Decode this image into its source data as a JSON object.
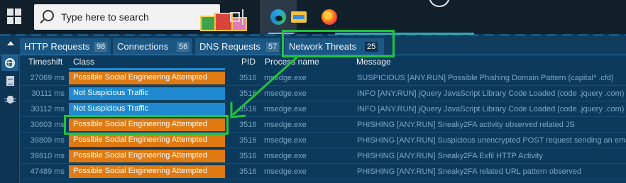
{
  "taskbar": {
    "search_placeholder": "Type here to search",
    "icons": [
      "windows-start-icon",
      "search-icon",
      "task-view-icon",
      "edge-icon",
      "file-explorer-icon",
      "firefox-icon"
    ]
  },
  "tabs": [
    {
      "label": "HTTP Requests",
      "count": "98"
    },
    {
      "label": "Connections",
      "count": "56"
    },
    {
      "label": "DNS Requests",
      "count": "57"
    },
    {
      "label": "Network Threats",
      "count": "25"
    }
  ],
  "columns": {
    "timeshift": "Timeshift",
    "class": "Class",
    "pid": "PID",
    "process": "Process name",
    "message": "Message"
  },
  "rows": [
    {
      "timeshift": "27069 ms",
      "class": "Possible Social Engineering Attempted",
      "type": "threat",
      "pid": "3516",
      "process": "msedge.exe",
      "message": "SUSPICIOUS [ANY.RUN] Possible Phishing Domain Pattern (capital* .cfd)"
    },
    {
      "timeshift": "30111 ms",
      "class": "Not Suspicious Traffic",
      "type": "ok",
      "pid": "3516",
      "process": "msedge.exe",
      "message": "INFO [ANY.RUN] jQuery JavaScript Library Code Loaded (code .jquery .com)"
    },
    {
      "timeshift": "30112 ms",
      "class": "Not Suspicious Traffic",
      "type": "ok",
      "pid": "3516",
      "process": "msedge.exe",
      "message": "INFO [ANY.RUN] jQuery JavaScript Library Code Loaded (code .jquery .com)"
    },
    {
      "timeshift": "30603 ms",
      "class": "Possible Social Engineering Attempted",
      "type": "threat",
      "pid": "3516",
      "process": "msedge.exe",
      "message": "PHISHING [ANY.RUN] Sneaky2FA activity observed related JS"
    },
    {
      "timeshift": "39809 ms",
      "class": "Possible Social Engineering Attempted",
      "type": "threat",
      "pid": "3516",
      "process": "msedge.exe",
      "message": "PHISHING [ANY.RUN] Suspicious unencrypted POST request sending an email a"
    },
    {
      "timeshift": "39810 ms",
      "class": "Possible Social Engineering Attempted",
      "type": "threat",
      "pid": "3516",
      "process": "msedge.exe",
      "message": "PHISHING [ANY.RUN] Sneaky2FA Exfil HTTP Activity"
    },
    {
      "timeshift": "47489 ms",
      "class": "Possible Social Engineering Attempted",
      "type": "threat",
      "pid": "3516",
      "process": "msedge.exe",
      "message": "PHISHING [ANY.RUN] Sneaky2FA related URL pattern observed"
    }
  ],
  "colors": {
    "threat": "#e07a12",
    "ok": "#1f8ad0",
    "highlight": "#22c43a",
    "background": "#0b3a5c"
  }
}
